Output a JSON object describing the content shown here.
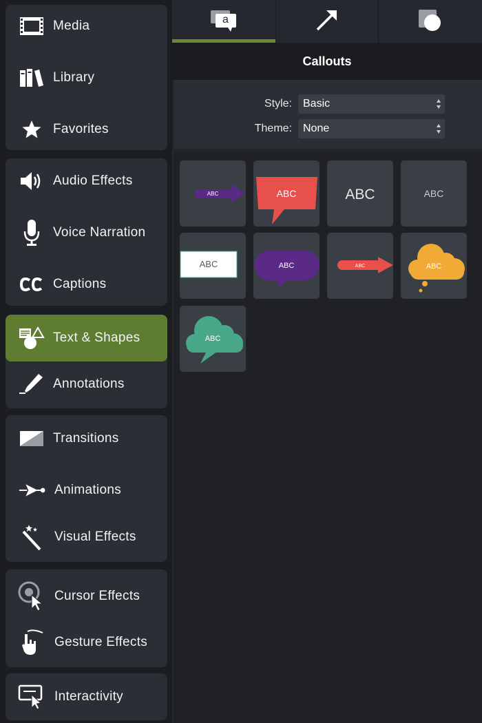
{
  "sidebar": {
    "groups": [
      {
        "items": [
          {
            "label": "Media",
            "icon": "film-strip-icon"
          },
          {
            "label": "Library",
            "icon": "books-icon"
          },
          {
            "label": "Favorites",
            "icon": "star-icon"
          }
        ]
      },
      {
        "items": [
          {
            "label": "Audio Effects",
            "icon": "speaker-icon"
          },
          {
            "label": "Voice Narration",
            "icon": "microphone-icon"
          },
          {
            "label": "Captions",
            "icon": "cc-icon"
          }
        ]
      },
      {
        "items": [
          {
            "label": "Text & Shapes",
            "icon": "text-shapes-icon",
            "active": true
          },
          {
            "label": "Annotations",
            "icon": "pen-icon"
          }
        ]
      },
      {
        "items": [
          {
            "label": "Transitions",
            "icon": "transition-icon"
          },
          {
            "label": "Animations",
            "icon": "animation-arrow-icon"
          },
          {
            "label": "Visual Effects",
            "icon": "magic-wand-icon"
          }
        ]
      },
      {
        "items": [
          {
            "label": "Cursor Effects",
            "icon": "cursor-effect-icon"
          },
          {
            "label": "Gesture Effects",
            "icon": "gesture-hand-icon"
          }
        ]
      },
      {
        "items": [
          {
            "label": "Interactivity",
            "icon": "interactivity-icon"
          }
        ]
      }
    ]
  },
  "tabs": [
    {
      "icon": "callout-icon",
      "glyph": "a",
      "active": true
    },
    {
      "icon": "arrow-icon",
      "active": false
    },
    {
      "icon": "shape-icon",
      "active": false
    }
  ],
  "panel": {
    "title": "Callouts",
    "style_label": "Style:",
    "style_value": "Basic",
    "theme_label": "Theme:",
    "theme_value": "None"
  },
  "colors": {
    "accent_green": "#5f7d31",
    "purple": "#5b2a86",
    "red": "#e8514b",
    "orange": "#f0aa35",
    "teal": "#4aa88a"
  },
  "callouts": [
    {
      "kind": "arrow-purple-small",
      "text": "ABC"
    },
    {
      "kind": "speech-box-red",
      "text": "ABC"
    },
    {
      "kind": "text-large",
      "text": "ABC"
    },
    {
      "kind": "text-small",
      "text": "ABC"
    },
    {
      "kind": "box-white",
      "text": "ABC"
    },
    {
      "kind": "speech-oval-purple",
      "text": "ABC"
    },
    {
      "kind": "arrow-red",
      "text": "ABC"
    },
    {
      "kind": "thought-cloud-orange",
      "text": "ABC"
    },
    {
      "kind": "speech-cloud-teal",
      "text": "ABC"
    }
  ]
}
